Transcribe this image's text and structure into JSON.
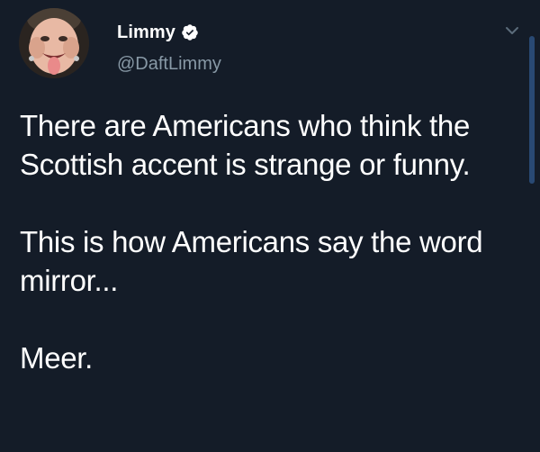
{
  "tweet": {
    "author": {
      "display_name": "Limmy",
      "handle": "@DaftLimmy",
      "verified": true
    },
    "body": {
      "paragraph_1": "There are Americans who think the Scottish accent is strange or funny.",
      "paragraph_2": "This is how Americans say the word mirror...",
      "paragraph_3": "Meer."
    }
  },
  "icons": {
    "verified": "verified-badge-icon",
    "caret": "chevron-down-icon"
  },
  "colors": {
    "background": "#141c28",
    "text_primary": "#ffffff",
    "text_secondary": "#8899a6",
    "accent": "#1da1f2"
  }
}
